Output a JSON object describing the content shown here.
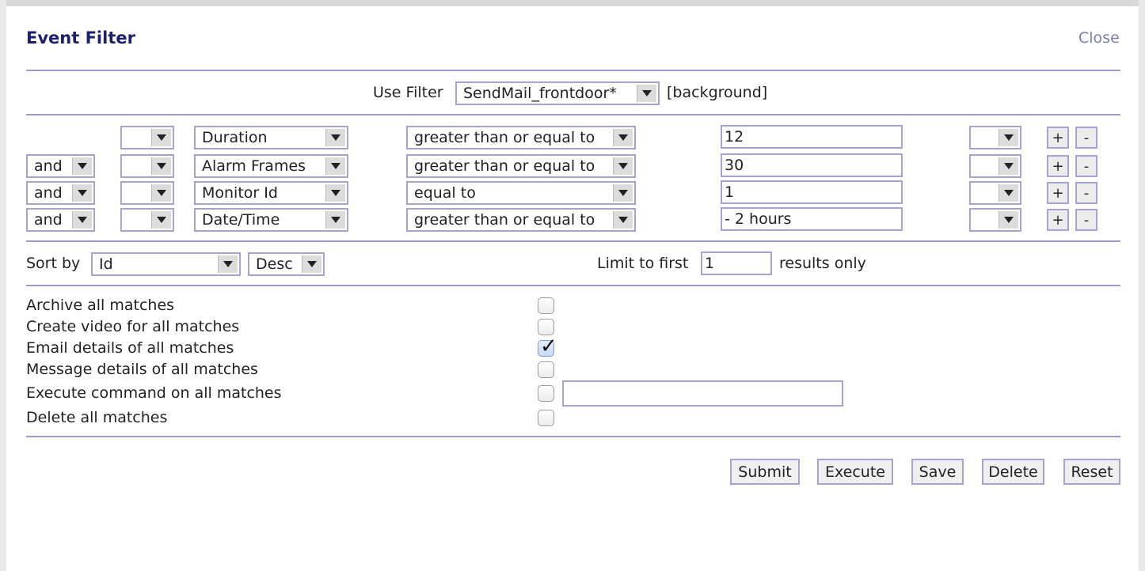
{
  "dialog": {
    "title": "Event Filter",
    "close_label": "Close"
  },
  "use_filter": {
    "label": "Use Filter",
    "selected": "SendMail_frontdoor*",
    "tag": "[background]"
  },
  "terms": [
    {
      "conjunction": "",
      "open_bracket": "",
      "attribute": "Duration",
      "operator": "greater than or equal to",
      "value": "12",
      "close_bracket": "",
      "add_label": "+",
      "remove_label": "-"
    },
    {
      "conjunction": "and",
      "open_bracket": "",
      "attribute": "Alarm Frames",
      "operator": "greater than or equal to",
      "value": "30",
      "close_bracket": "",
      "add_label": "+",
      "remove_label": "-"
    },
    {
      "conjunction": "and",
      "open_bracket": "",
      "attribute": "Monitor Id",
      "operator": "equal to",
      "value": "1",
      "close_bracket": "",
      "add_label": "+",
      "remove_label": "-"
    },
    {
      "conjunction": "and",
      "open_bracket": "",
      "attribute": "Date/Time",
      "operator": "greater than or equal to",
      "value": "- 2 hours",
      "close_bracket": "",
      "add_label": "+",
      "remove_label": "-"
    }
  ],
  "sort": {
    "label": "Sort by",
    "field": "Id",
    "direction": "Desc"
  },
  "limit": {
    "label": "Limit to first",
    "value": "1",
    "suffix": "results only"
  },
  "actions": [
    {
      "label": "Archive all matches",
      "checked": false
    },
    {
      "label": "Create video for all matches",
      "checked": false
    },
    {
      "label": "Email details of all matches",
      "checked": true
    },
    {
      "label": "Message details of all matches",
      "checked": false
    },
    {
      "label": "Execute command on all matches",
      "checked": false,
      "command": ""
    },
    {
      "label": "Delete all matches",
      "checked": false
    }
  ],
  "buttons": {
    "submit": "Submit",
    "execute": "Execute",
    "save": "Save",
    "delete": "Delete",
    "reset": "Reset"
  },
  "icons": {
    "dropdown": "chevron-down-icon",
    "check": "checkmark-icon"
  },
  "colors": {
    "title": "#1c1f6b",
    "border": "#a5a3cf",
    "divider": "#9b99c7",
    "close_link": "#7a7fb0"
  }
}
